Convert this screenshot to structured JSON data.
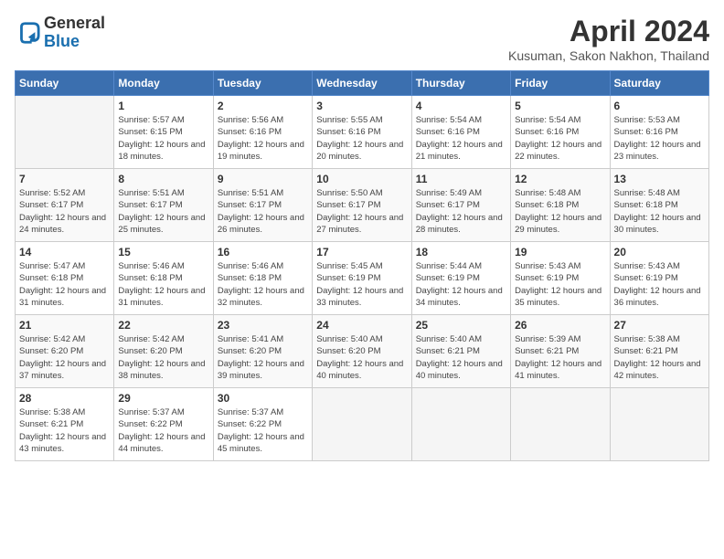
{
  "logo": {
    "general": "General",
    "blue": "Blue"
  },
  "header": {
    "title": "April 2024",
    "subtitle": "Kusuman, Sakon Nakhon, Thailand"
  },
  "days_of_week": [
    "Sunday",
    "Monday",
    "Tuesday",
    "Wednesday",
    "Thursday",
    "Friday",
    "Saturday"
  ],
  "weeks": [
    [
      {
        "day": "",
        "sunrise": "",
        "sunset": "",
        "daylight": ""
      },
      {
        "day": "1",
        "sunrise": "Sunrise: 5:57 AM",
        "sunset": "Sunset: 6:15 PM",
        "daylight": "Daylight: 12 hours and 18 minutes."
      },
      {
        "day": "2",
        "sunrise": "Sunrise: 5:56 AM",
        "sunset": "Sunset: 6:16 PM",
        "daylight": "Daylight: 12 hours and 19 minutes."
      },
      {
        "day": "3",
        "sunrise": "Sunrise: 5:55 AM",
        "sunset": "Sunset: 6:16 PM",
        "daylight": "Daylight: 12 hours and 20 minutes."
      },
      {
        "day": "4",
        "sunrise": "Sunrise: 5:54 AM",
        "sunset": "Sunset: 6:16 PM",
        "daylight": "Daylight: 12 hours and 21 minutes."
      },
      {
        "day": "5",
        "sunrise": "Sunrise: 5:54 AM",
        "sunset": "Sunset: 6:16 PM",
        "daylight": "Daylight: 12 hours and 22 minutes."
      },
      {
        "day": "6",
        "sunrise": "Sunrise: 5:53 AM",
        "sunset": "Sunset: 6:16 PM",
        "daylight": "Daylight: 12 hours and 23 minutes."
      }
    ],
    [
      {
        "day": "7",
        "sunrise": "Sunrise: 5:52 AM",
        "sunset": "Sunset: 6:17 PM",
        "daylight": "Daylight: 12 hours and 24 minutes."
      },
      {
        "day": "8",
        "sunrise": "Sunrise: 5:51 AM",
        "sunset": "Sunset: 6:17 PM",
        "daylight": "Daylight: 12 hours and 25 minutes."
      },
      {
        "day": "9",
        "sunrise": "Sunrise: 5:51 AM",
        "sunset": "Sunset: 6:17 PM",
        "daylight": "Daylight: 12 hours and 26 minutes."
      },
      {
        "day": "10",
        "sunrise": "Sunrise: 5:50 AM",
        "sunset": "Sunset: 6:17 PM",
        "daylight": "Daylight: 12 hours and 27 minutes."
      },
      {
        "day": "11",
        "sunrise": "Sunrise: 5:49 AM",
        "sunset": "Sunset: 6:17 PM",
        "daylight": "Daylight: 12 hours and 28 minutes."
      },
      {
        "day": "12",
        "sunrise": "Sunrise: 5:48 AM",
        "sunset": "Sunset: 6:18 PM",
        "daylight": "Daylight: 12 hours and 29 minutes."
      },
      {
        "day": "13",
        "sunrise": "Sunrise: 5:48 AM",
        "sunset": "Sunset: 6:18 PM",
        "daylight": "Daylight: 12 hours and 30 minutes."
      }
    ],
    [
      {
        "day": "14",
        "sunrise": "Sunrise: 5:47 AM",
        "sunset": "Sunset: 6:18 PM",
        "daylight": "Daylight: 12 hours and 31 minutes."
      },
      {
        "day": "15",
        "sunrise": "Sunrise: 5:46 AM",
        "sunset": "Sunset: 6:18 PM",
        "daylight": "Daylight: 12 hours and 31 minutes."
      },
      {
        "day": "16",
        "sunrise": "Sunrise: 5:46 AM",
        "sunset": "Sunset: 6:18 PM",
        "daylight": "Daylight: 12 hours and 32 minutes."
      },
      {
        "day": "17",
        "sunrise": "Sunrise: 5:45 AM",
        "sunset": "Sunset: 6:19 PM",
        "daylight": "Daylight: 12 hours and 33 minutes."
      },
      {
        "day": "18",
        "sunrise": "Sunrise: 5:44 AM",
        "sunset": "Sunset: 6:19 PM",
        "daylight": "Daylight: 12 hours and 34 minutes."
      },
      {
        "day": "19",
        "sunrise": "Sunrise: 5:43 AM",
        "sunset": "Sunset: 6:19 PM",
        "daylight": "Daylight: 12 hours and 35 minutes."
      },
      {
        "day": "20",
        "sunrise": "Sunrise: 5:43 AM",
        "sunset": "Sunset: 6:19 PM",
        "daylight": "Daylight: 12 hours and 36 minutes."
      }
    ],
    [
      {
        "day": "21",
        "sunrise": "Sunrise: 5:42 AM",
        "sunset": "Sunset: 6:20 PM",
        "daylight": "Daylight: 12 hours and 37 minutes."
      },
      {
        "day": "22",
        "sunrise": "Sunrise: 5:42 AM",
        "sunset": "Sunset: 6:20 PM",
        "daylight": "Daylight: 12 hours and 38 minutes."
      },
      {
        "day": "23",
        "sunrise": "Sunrise: 5:41 AM",
        "sunset": "Sunset: 6:20 PM",
        "daylight": "Daylight: 12 hours and 39 minutes."
      },
      {
        "day": "24",
        "sunrise": "Sunrise: 5:40 AM",
        "sunset": "Sunset: 6:20 PM",
        "daylight": "Daylight: 12 hours and 40 minutes."
      },
      {
        "day": "25",
        "sunrise": "Sunrise: 5:40 AM",
        "sunset": "Sunset: 6:21 PM",
        "daylight": "Daylight: 12 hours and 40 minutes."
      },
      {
        "day": "26",
        "sunrise": "Sunrise: 5:39 AM",
        "sunset": "Sunset: 6:21 PM",
        "daylight": "Daylight: 12 hours and 41 minutes."
      },
      {
        "day": "27",
        "sunrise": "Sunrise: 5:38 AM",
        "sunset": "Sunset: 6:21 PM",
        "daylight": "Daylight: 12 hours and 42 minutes."
      }
    ],
    [
      {
        "day": "28",
        "sunrise": "Sunrise: 5:38 AM",
        "sunset": "Sunset: 6:21 PM",
        "daylight": "Daylight: 12 hours and 43 minutes."
      },
      {
        "day": "29",
        "sunrise": "Sunrise: 5:37 AM",
        "sunset": "Sunset: 6:22 PM",
        "daylight": "Daylight: 12 hours and 44 minutes."
      },
      {
        "day": "30",
        "sunrise": "Sunrise: 5:37 AM",
        "sunset": "Sunset: 6:22 PM",
        "daylight": "Daylight: 12 hours and 45 minutes."
      },
      {
        "day": "",
        "sunrise": "",
        "sunset": "",
        "daylight": ""
      },
      {
        "day": "",
        "sunrise": "",
        "sunset": "",
        "daylight": ""
      },
      {
        "day": "",
        "sunrise": "",
        "sunset": "",
        "daylight": ""
      },
      {
        "day": "",
        "sunrise": "",
        "sunset": "",
        "daylight": ""
      }
    ]
  ]
}
